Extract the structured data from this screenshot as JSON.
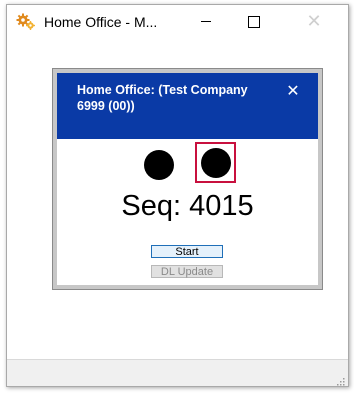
{
  "window": {
    "title": "Home Office - M...",
    "app_icon": "gears-icon",
    "controls": {
      "minimize": "minimize-icon",
      "maximize": "maximize-icon",
      "close": "close-icon"
    }
  },
  "dialog": {
    "title": "Home Office: (Test Company 6999 (00))",
    "close_glyph": "✕",
    "indicator_colors": [
      "#000000",
      "#000000"
    ],
    "selected_indicator_border": "#c8103e",
    "seq_text": "Seq: 4015",
    "buttons": {
      "start_label": "Start",
      "dl_update_label": "DL Update"
    }
  },
  "colors": {
    "header_blue": "#0a3aa6",
    "dialog_frame": "#c7c7c7"
  }
}
